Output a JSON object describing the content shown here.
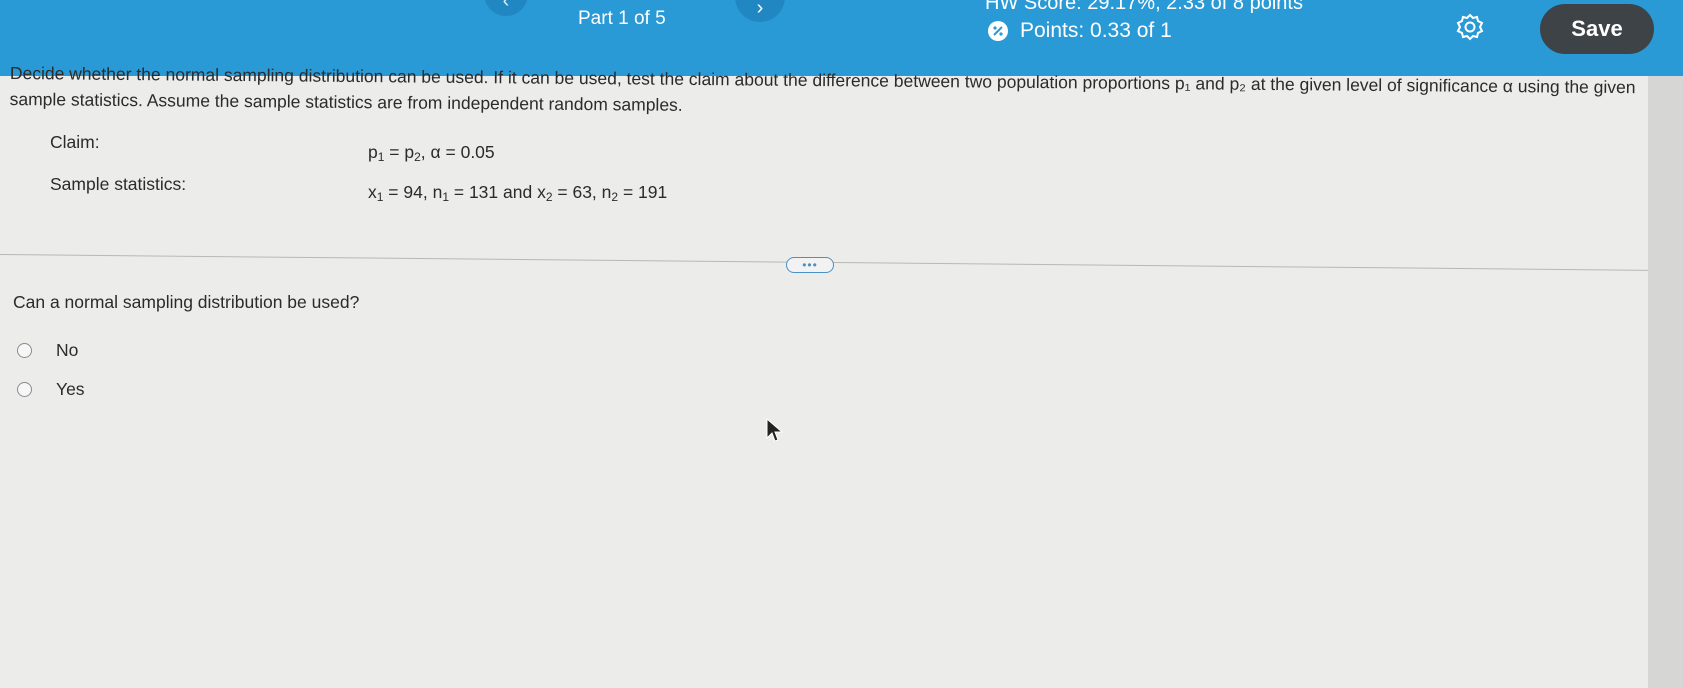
{
  "header": {
    "part_label": "Part 1 of 5",
    "prev_icon": "chevron-left-icon",
    "next_icon": "chevron-right-icon",
    "hw_score": "HW Score: 29.17%, 2.33 of 8 points",
    "points": "Points: 0.33 of 1",
    "points_icon": "partial-credit-icon",
    "settings_icon": "gear-icon",
    "save_label": "Save",
    "bar_color": "#2a9ad6",
    "save_color": "#3d4347"
  },
  "question": {
    "text": "Decide whether the normal sampling distribution can be used. If it can be used, test the claim about the difference between two population proportions p₁ and p₂ at the given level of significance α using the given sample statistics. Assume the sample statistics are from independent random samples.",
    "claim_label": "Claim:",
    "sample_label": "Sample statistics:"
  },
  "part": {
    "prompt": "Can a normal sampling distribution be used?",
    "options": [
      "No",
      "Yes"
    ],
    "expand_icon": "more-dots-icon"
  }
}
